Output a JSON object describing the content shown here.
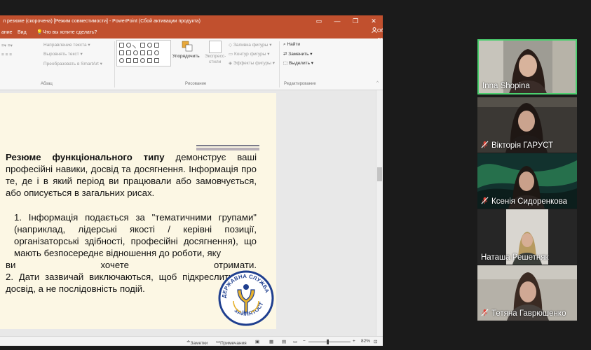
{
  "ppt": {
    "title_text": "л резюме (скорочена) [Режим совместимости] - PowerPoint (Сбой активации продукта)",
    "menu_left": "ание",
    "menu_view": "Вид",
    "tell_me": "Что вы хотите сделать?",
    "share": "Общий доступ",
    "ribbon": {
      "text_direction": "Направление текста",
      "align_text": "Выровнять текст",
      "smartart": "Преобразовать в SmartArt",
      "paragraph_group": "Абзац",
      "arrange": "Упорядочить",
      "quick_styles_1": "Экспресс-",
      "quick_styles_2": "стили",
      "shape_fill": "Заливка фигуры",
      "shape_outline": "Контур фигуры",
      "shape_effects": "Эффекты фигуры",
      "drawing_group": "Рисование",
      "find": "Найти",
      "replace": "Заменить",
      "select": "Выделить",
      "editing_group": "Редактирование"
    },
    "slide": {
      "p1_bold": "Резюме функціонального типу",
      "p1_rest": " демонструє ваші професійні навики, досвід та досягнення. Інформація про те, де і в який період ви працювали або замовчується, або описується в загальних рисах.",
      "p2_main": "1. Інформація подається за \"тематичними групами\" (наприклад, лідерські якості / керівні позиції, організаторські здібності, професійні досягнення), що мають безпосереднє відношення до роботи, яку",
      "p2_last_1": "ви",
      "p2_last_2": "хочете",
      "p2_last_3": "отримати.",
      "p3": "2. Дати зазвичай виключаються, щоб підкреслити ваш досвід, а не послідовність подій.",
      "logo_top": "ДЕРЖАВНА СЛУЖБА",
      "logo_bottom": "ЗАЙНЯТОСТІ"
    },
    "status": {
      "notes": "Заметки",
      "comments": "Примечания",
      "zoom": "82%"
    }
  },
  "participants": [
    {
      "name": "Inna Shopina",
      "muted": false,
      "active": true
    },
    {
      "name": "Вікторія ГАРУСТ",
      "muted": true,
      "active": false
    },
    {
      "name": "Ксенія Сидоренкова",
      "muted": true,
      "active": false
    },
    {
      "name": "Наташа Решетняк",
      "muted": false,
      "active": false
    },
    {
      "name": "Тетяна Гаврюшенко",
      "muted": true,
      "active": false
    }
  ],
  "colors": {
    "ppt_accent": "#c1502e",
    "active_speaker": "#4ccf6f",
    "mute_icon": "#e0463a",
    "slide_bg": "#fcf7e4",
    "logo_blue": "#1f3f8f",
    "logo_gold": "#e7b22c"
  }
}
